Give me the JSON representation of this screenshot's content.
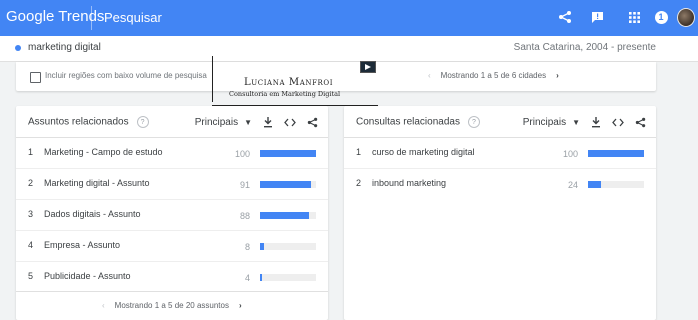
{
  "header": {
    "logo_google": "Google",
    "logo_trends": "Trends",
    "search_label": "Pesquisar",
    "notification_count": "1",
    "icons": [
      "share-icon",
      "feedback-icon",
      "apps-icon",
      "account-avatar"
    ],
    "accent_color": "#4285f4"
  },
  "subbar": {
    "term": "marketing digital",
    "region_period": "Santa Catarina, 2004 - presente",
    "term_color": "#4285f4"
  },
  "region_panel": {
    "checkbox_label": "Incluir regiões com baixo volume de pesquisa",
    "checkbox_checked": false,
    "pager_text": "Mostrando 1 a 5 de 6 cidades"
  },
  "watermark": {
    "name": "Luciana Manfroi",
    "subtitle": "Consultoria em Marketing Digital"
  },
  "related_topics": {
    "title": "Assuntos relacionados",
    "filter": "Principais",
    "rows": [
      {
        "rank": "1",
        "label": "Marketing - Campo de estudo",
        "value": "100",
        "level": 100
      },
      {
        "rank": "2",
        "label": "Marketing digital - Assunto",
        "value": "91",
        "level": 91
      },
      {
        "rank": "3",
        "label": "Dados digitais - Assunto",
        "value": "88",
        "level": 88
      },
      {
        "rank": "4",
        "label": "Empresa - Assunto",
        "value": "8",
        "level": 8
      },
      {
        "rank": "5",
        "label": "Publicidade - Assunto",
        "value": "4",
        "level": 4
      }
    ],
    "pager_text": "Mostrando 1 a 5 de 20 assuntos"
  },
  "related_queries": {
    "title": "Consultas relacionadas",
    "filter": "Principais",
    "rows": [
      {
        "rank": "1",
        "label": "curso de marketing digital",
        "value": "100",
        "level": 100
      },
      {
        "rank": "2",
        "label": "inbound marketing",
        "value": "24",
        "level": 24
      }
    ]
  }
}
